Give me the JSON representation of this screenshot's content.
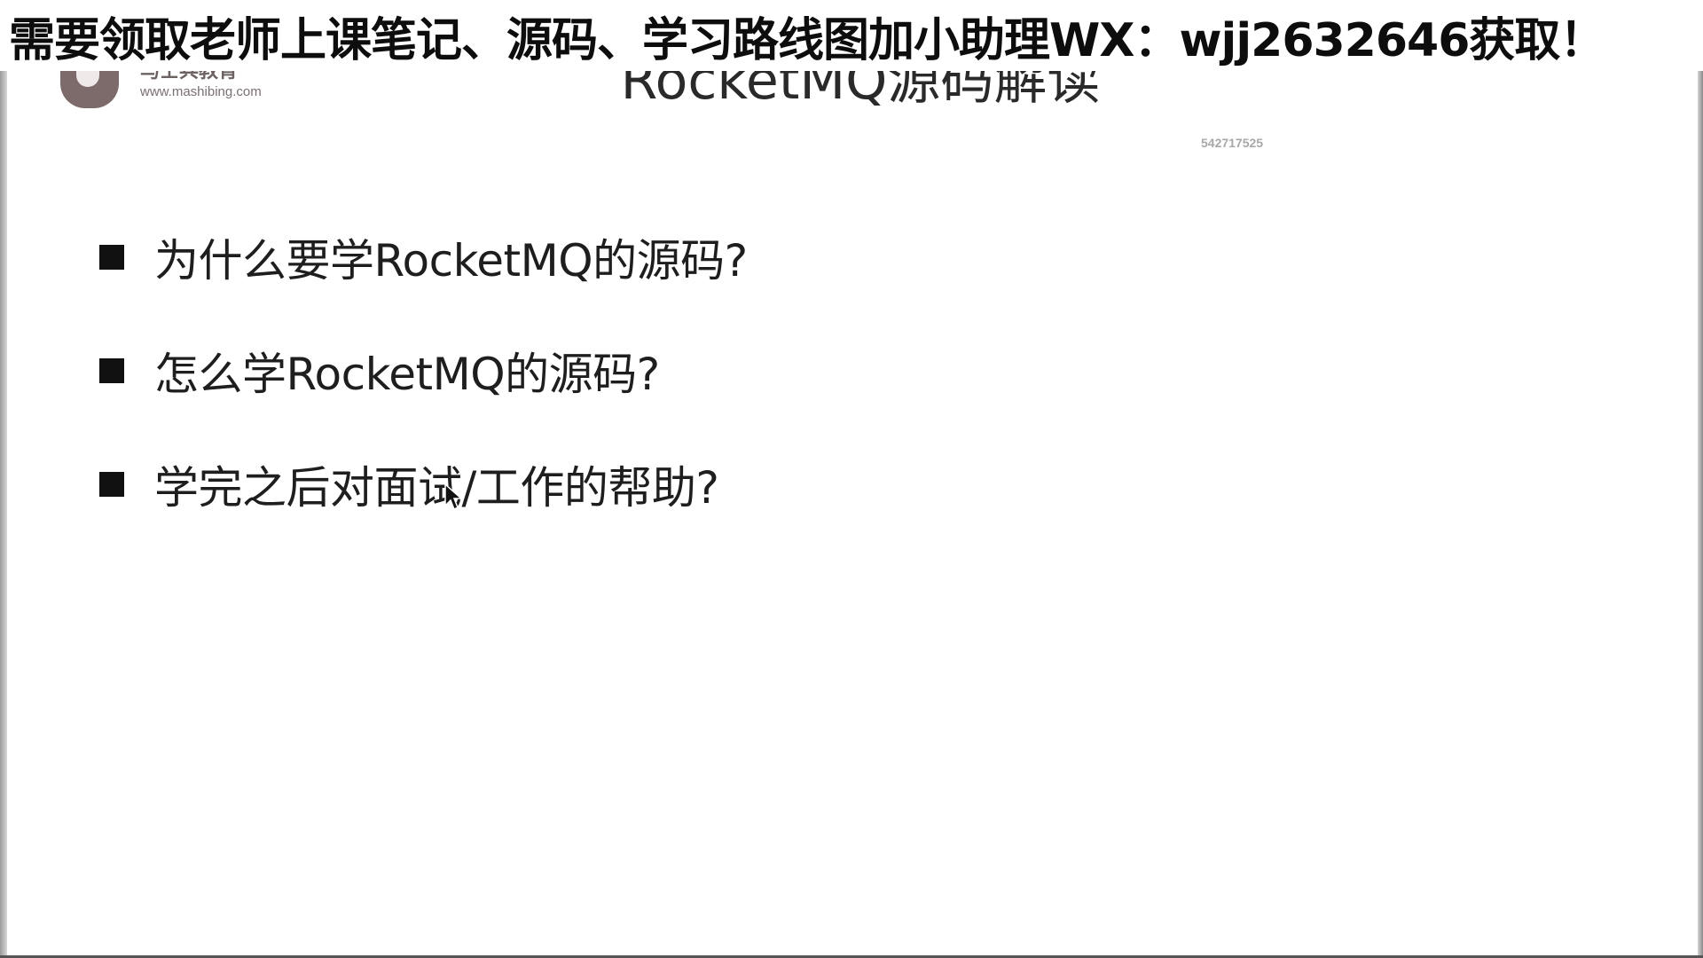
{
  "banner": {
    "text": "需要领取老师上课笔记、源码、学习路线图加小助理WX：wjj2632646获取！"
  },
  "logo": {
    "name": "马士兵教育",
    "url": "www.mashibing.com"
  },
  "slide": {
    "title": "RocketMQ源码解读",
    "watermark_id": "542717525",
    "bullets": [
      "为什么要学RocketMQ的源码?",
      "怎么学RocketMQ的源码?",
      "学完之后对面试/工作的帮助?"
    ]
  },
  "colors": {
    "banner_text": "#0d0d0d",
    "logo": "#7d6a6a",
    "bullet": "#111111",
    "background": "#ffffff"
  },
  "icons": {
    "logo": "mashibing-logo-icon",
    "bullet": "square-bullet-icon",
    "cursor": "mouse-pointer-icon"
  }
}
